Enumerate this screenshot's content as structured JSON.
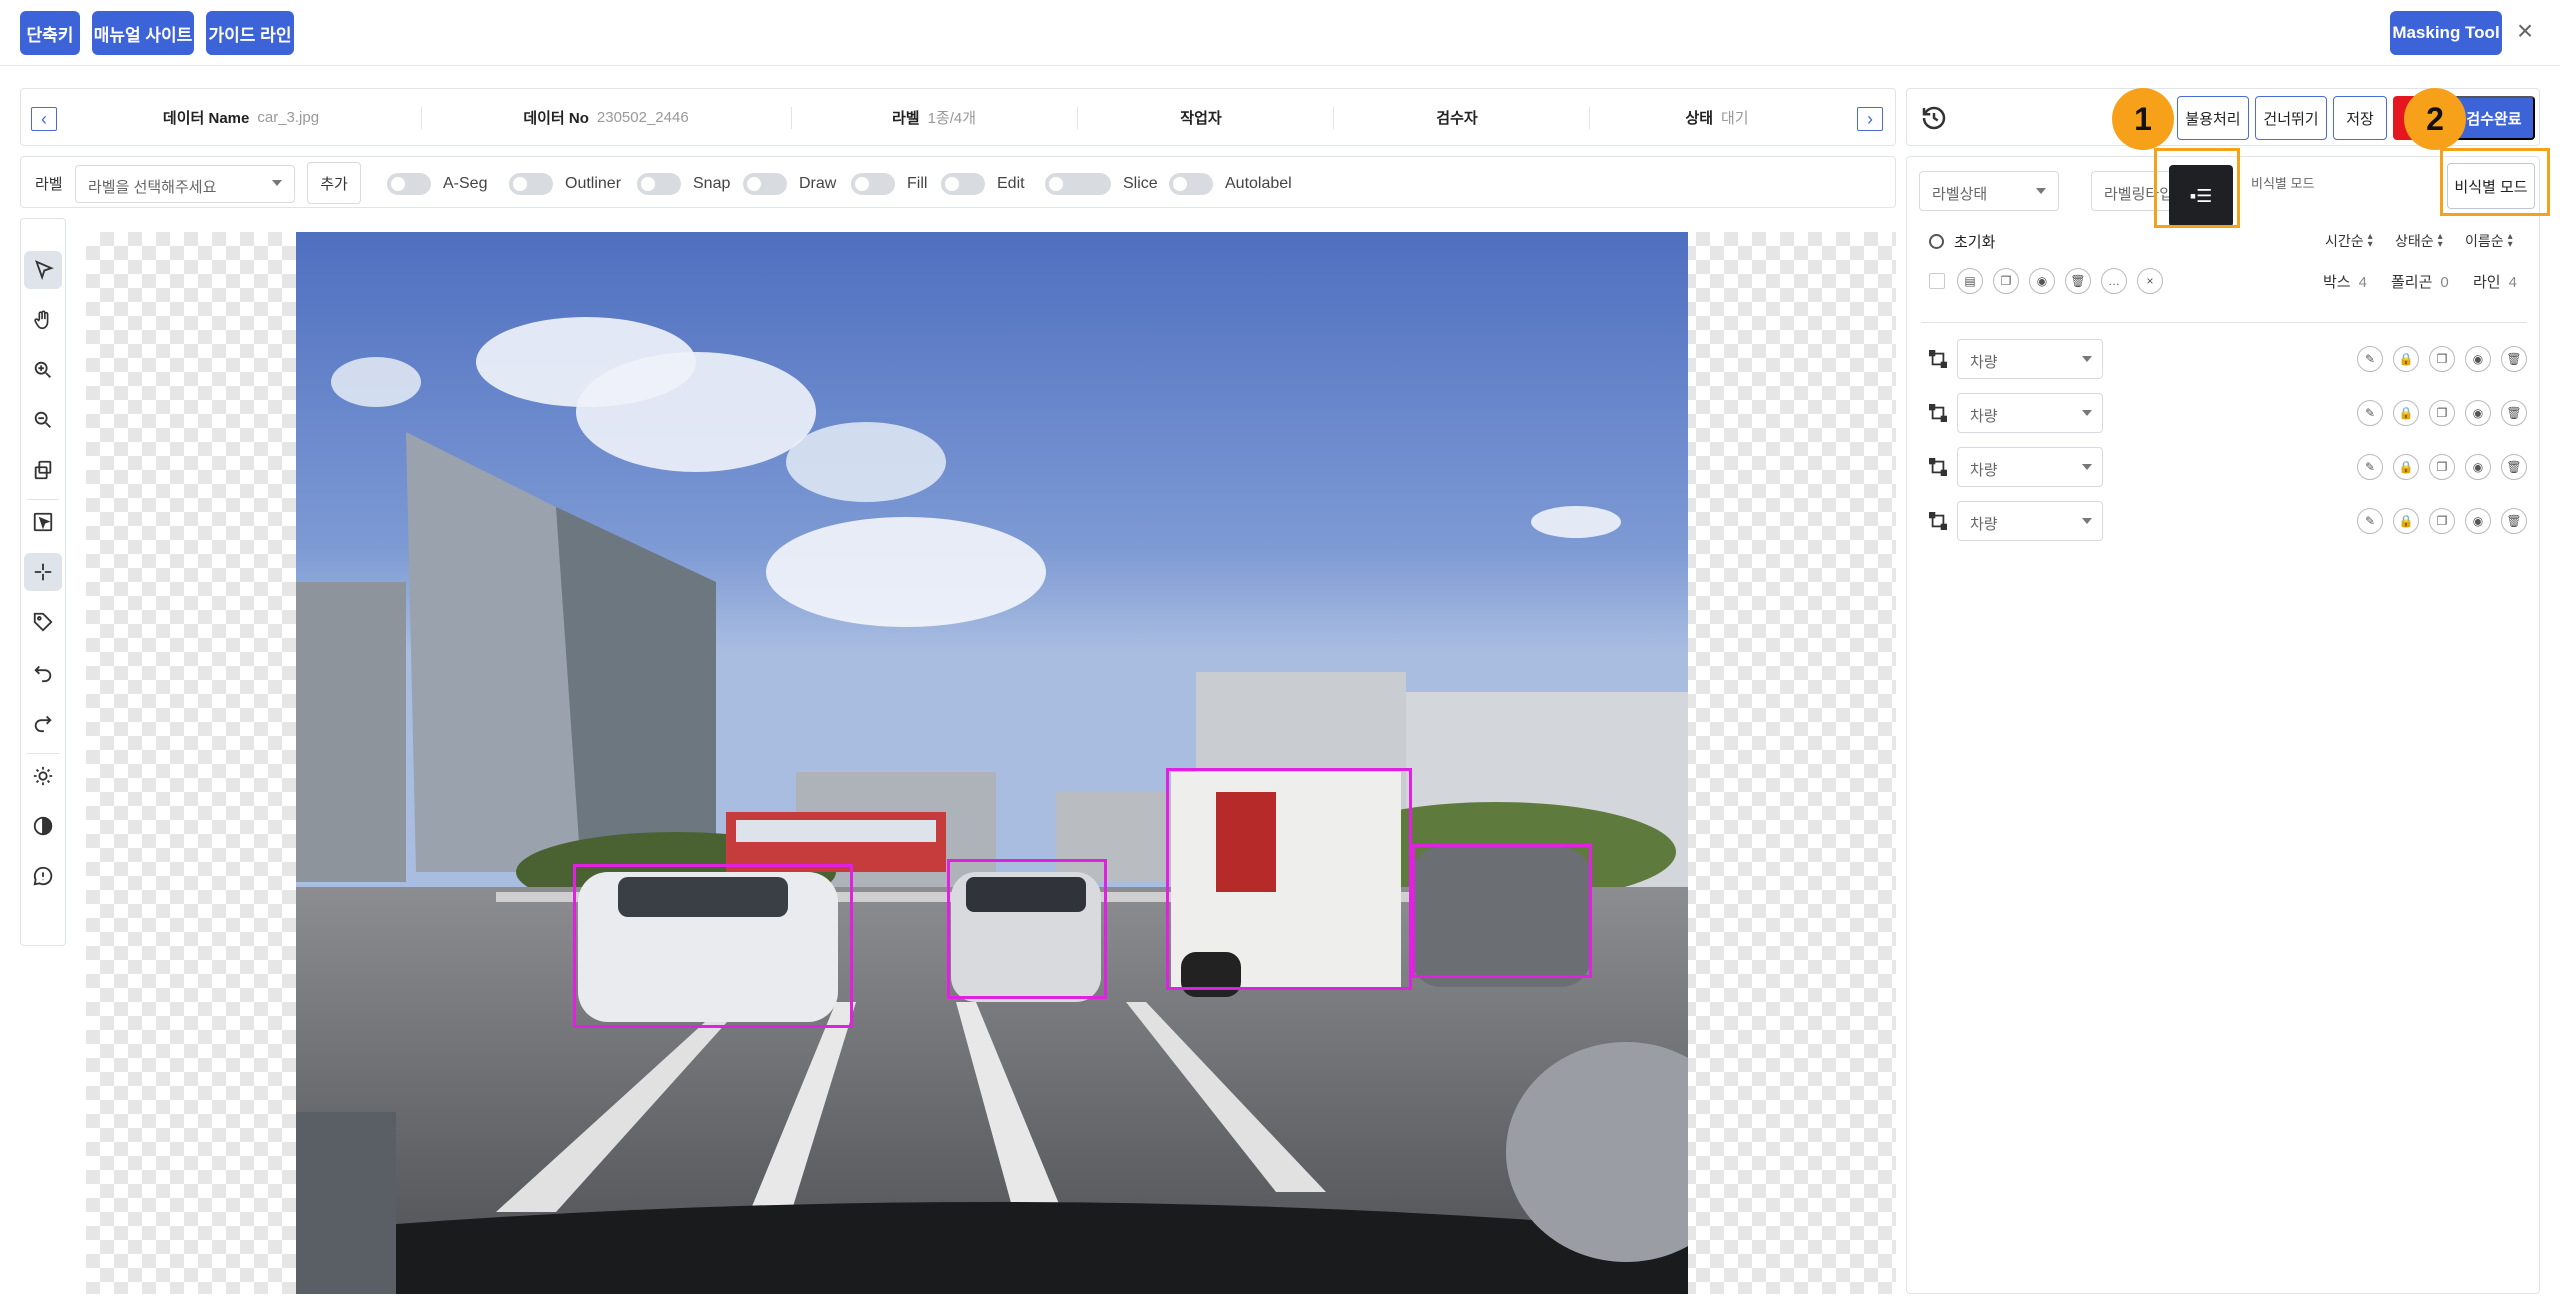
{
  "header": {
    "buttons": [
      "단축키",
      "매뉴얼 사이트",
      "가이드 라인"
    ],
    "masking_tool": "Masking Tool"
  },
  "info": {
    "prev_icon": "chevron-left-icon",
    "next_icon": "chevron-right-icon",
    "fields": [
      {
        "key": "데이터 Name",
        "value": "car_3.jpg"
      },
      {
        "key": "데이터 No",
        "value": "230502_2446"
      },
      {
        "key": "라벨",
        "value": "1종/4개"
      },
      {
        "key": "작업자",
        "value": ""
      },
      {
        "key": "검수자",
        "value": ""
      },
      {
        "key": "상태",
        "value": "대기"
      }
    ]
  },
  "toolbar": {
    "label": "라벨",
    "select_placeholder": "라벨을 선택해주세요",
    "add": "추가",
    "toggles": [
      "A-Seg",
      "Outliner",
      "Snap",
      "Draw",
      "Fill",
      "Edit",
      "Slice",
      "Autolabel"
    ]
  },
  "tools": [
    "select-pointer-icon",
    "hand-icon",
    "zoom-in-icon",
    "zoom-out-icon",
    "copy-layer-icon",
    "box-select-icon",
    "crosshair-icon",
    "tag-icon",
    "undo-icon",
    "redo-icon",
    "brightness-icon",
    "contrast-icon",
    "alert-icon"
  ],
  "actions": {
    "history_icon": "history-icon",
    "reject": "불용처리",
    "skip": "건너뛰기",
    "save": "저장",
    "done": "검수완료"
  },
  "panel": {
    "status_select": "라벨상태",
    "group_select": "라벨링타입",
    "mode_icon": "list-mode-icon",
    "mode_text": "비식별 모드",
    "mode_button": "비식별 모드",
    "callouts": [
      "1",
      "2"
    ],
    "reset": "초기화",
    "sorts": [
      "시간순",
      "상태순",
      "이름순"
    ],
    "counts": [
      {
        "label": "박스",
        "value": "4"
      },
      {
        "label": "폴리곤",
        "value": "0"
      },
      {
        "label": "라인",
        "value": "4"
      }
    ],
    "labels": [
      {
        "class": "차량"
      },
      {
        "class": "차량"
      },
      {
        "class": "차량"
      },
      {
        "class": "차량"
      }
    ]
  },
  "colors": {
    "accent": "#3d63d8",
    "danger": "#e5161f",
    "bbox": "#e022e0",
    "highlight": "#f5a21b"
  }
}
